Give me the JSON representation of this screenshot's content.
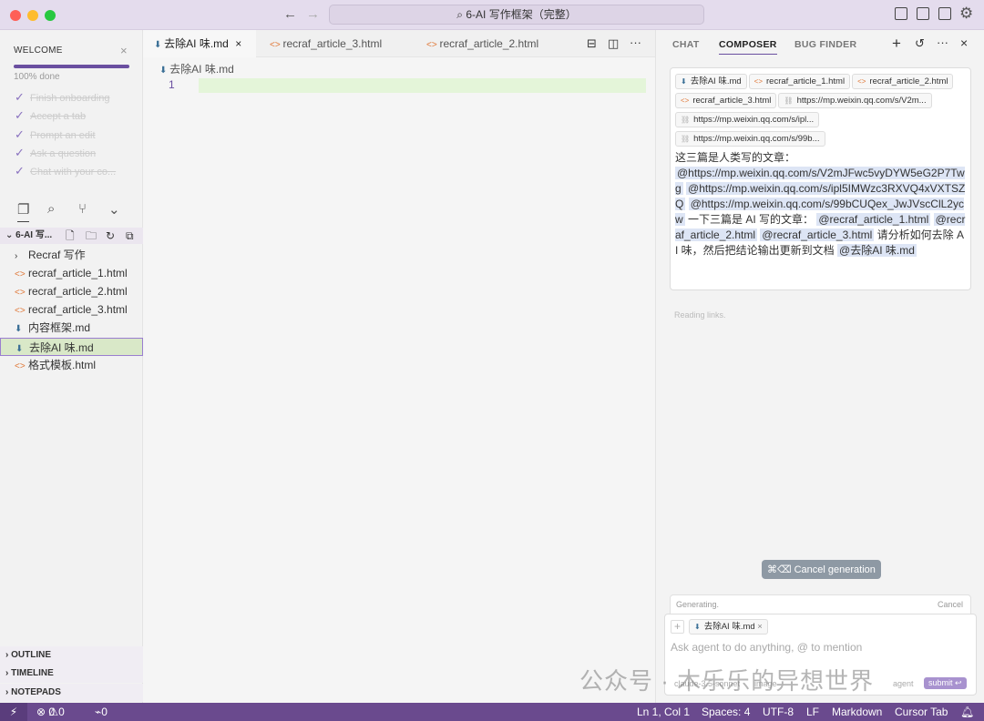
{
  "window": {
    "title": "6-AI 写作框架（完整）"
  },
  "welcome": {
    "title": "WELCOME",
    "progress_label": "100% done",
    "progress_percent": 100,
    "tasks": [
      "Finish onboarding",
      "Accept a tab",
      "Prompt an edit",
      "Ask a question",
      "Chat with your co..."
    ]
  },
  "explorer": {
    "project": "6-AI 写...",
    "items": [
      {
        "label": "Recraf 写作",
        "type": "folder"
      },
      {
        "label": "recraf_article_1.html",
        "type": "html"
      },
      {
        "label": "recraf_article_2.html",
        "type": "html"
      },
      {
        "label": "recraf_article_3.html",
        "type": "html"
      },
      {
        "label": "内容框架.md",
        "type": "md"
      },
      {
        "label": "去除AI 味.md",
        "type": "md",
        "selected": true
      },
      {
        "label": "格式模板.html",
        "type": "html"
      }
    ]
  },
  "sections": [
    "OUTLINE",
    "TIMELINE",
    "NOTEPADS"
  ],
  "editor": {
    "tabs": [
      "去除AI 味.md",
      "recraf_article_3.html",
      "recraf_article_2.html"
    ],
    "breadcrumb": "去除AI 味.md",
    "line": "1"
  },
  "panel": {
    "tabs": [
      "CHAT",
      "COMPOSER",
      "BUG FINDER"
    ],
    "chips": [
      "去除AI 味.md",
      "recraf_article_1.html",
      "recraf_article_2.html",
      "recraf_article_3.html",
      "https://mp.weixin.qq.com/s/V2m...",
      "https://mp.weixin.qq.com/s/ipl...",
      "https://mp.weixin.qq.com/s/99b..."
    ],
    "message": {
      "t1": "这三篇是人类写的文章：",
      "m1": "@https://mp.weixin.qq.com/s/V2mJFwc5vyDYW5eG2P7Twg",
      "m2": "@https://mp.weixin.qq.com/s/ipl5IMWzc3RXVQ4xVXTSZQ",
      "m3": "@https://mp.weixin.qq.com/s/99bCUQex_JwJVscClL2ycw",
      "t2": " 一下三篇是 AI 写的文章：",
      "m4": "@recraf_article_1.html",
      "m5": "@recraf_article_2.html",
      "m6": "@recraf_article_3.html",
      "t3": " 请分析如何去除 AI 味，然后把结论输出更新到文档 ",
      "m7": "@去除AI 味.md"
    },
    "reading": "Reading links.",
    "cancel_generation": "⌘⌫ Cancel generation",
    "generating": "Generating.",
    "cancel": "Cancel",
    "input_chip": "去除AI 味.md",
    "placeholder": "Ask agent to do anything, @ to mention",
    "model": "claude-3.5-sonnet",
    "image": "image",
    "mode": "agent",
    "submit": "submit ↩"
  },
  "status": {
    "errors": "0",
    "warnings": "0",
    "ports": "0",
    "position": "Ln 1, Col 1",
    "spaces": "Spaces: 4",
    "encoding": "UTF-8",
    "eol": "LF",
    "language": "Markdown",
    "cursor_tab": "Cursor Tab"
  },
  "watermark": "公众号 · 木乐乐的异想世界",
  "colors": {
    "accent": "#6a4a8e",
    "selection": "#d9e8c8"
  }
}
